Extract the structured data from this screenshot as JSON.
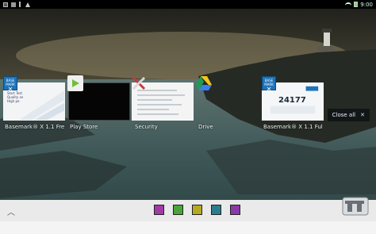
{
  "status_bar": {
    "time": "9:00",
    "icons": [
      "photo-icon",
      "notification-icon",
      "usb-icon",
      "warning-icon",
      "wifi-icon",
      "battery-icon"
    ]
  },
  "recent_apps": [
    {
      "label": "Basemark® X 1.1 Fre",
      "icon": "basemark-x-icon",
      "badge_text": "BASE MARK"
    },
    {
      "label": "Play Store",
      "icon": "play-store-icon"
    },
    {
      "label": "Security",
      "icon": "security-tools-icon"
    },
    {
      "label": "Drive",
      "icon": "google-drive-icon"
    },
    {
      "label": "Basemark® X 1.1 Ful",
      "icon": "basemark-x-icon",
      "badge_text": "BASE MARK",
      "score": "24177"
    }
  ],
  "close_all": {
    "label": "Close all"
  },
  "dock": {
    "apps": [
      {
        "icon": "purple-app-icon",
        "color": "#a03aa8"
      },
      {
        "icon": "green-app-icon",
        "color": "#4aa43a"
      },
      {
        "icon": "yellow-app-icon",
        "color": "#b5a823"
      },
      {
        "icon": "teal-app-icon",
        "color": "#2a7d8c"
      },
      {
        "icon": "violet-app-icon",
        "color": "#8a3aa8"
      }
    ]
  },
  "colors": {
    "sky_top": "#1c1d19",
    "horizon": "#c2b48a",
    "sea": "#3f5b5b",
    "navbar": "#eaeaea",
    "basemark_blue": "#1e73b8"
  }
}
